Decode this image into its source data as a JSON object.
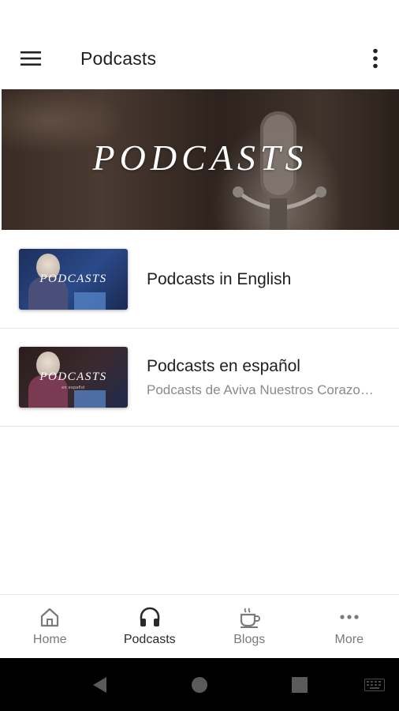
{
  "app_bar": {
    "title": "Podcasts",
    "menu_icon": "hamburger-menu-icon",
    "overflow_icon": "more-vert-icon"
  },
  "hero": {
    "title": "PODCASTS"
  },
  "list": [
    {
      "thumbnail_text": "PODCASTS",
      "thumbnail_subtext": "",
      "title": "Podcasts in English",
      "subtitle": ""
    },
    {
      "thumbnail_text": "PODCASTS",
      "thumbnail_subtext": "en español",
      "title": "Podcasts en español",
      "subtitle": "Podcasts de Aviva Nuestros Corazones"
    }
  ],
  "bottom_nav": {
    "items": [
      {
        "label": "Home",
        "icon": "home-icon",
        "active": false
      },
      {
        "label": "Podcasts",
        "icon": "headphones-icon",
        "active": true
      },
      {
        "label": "Blogs",
        "icon": "coffee-cup-icon",
        "active": false
      },
      {
        "label": "More",
        "icon": "more-horiz-icon",
        "active": false
      }
    ]
  },
  "colors": {
    "nav_active": "#2a2a2a",
    "nav_inactive": "#7a7a7a",
    "subtitle": "#8a8a8a",
    "system_nav": "#000000"
  }
}
